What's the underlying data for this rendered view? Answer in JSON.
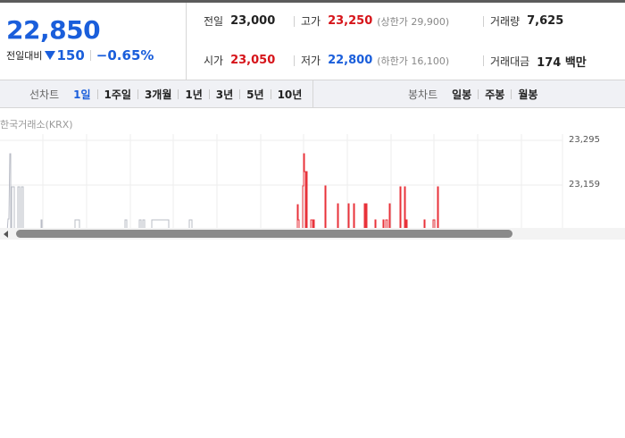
{
  "summary": {
    "price": "22,850",
    "change_label": "전일대비",
    "change_abs": "150",
    "change_pct": "−0.65%",
    "direction": "down",
    "prev_close_label": "전일",
    "prev_close": "23,000",
    "open_label": "시가",
    "open": "23,050",
    "high_label": "고가",
    "high": "23,250",
    "upper_limit": "(상한가 29,900)",
    "low_label": "저가",
    "low": "22,800",
    "lower_limit": "(하한가 16,100)",
    "volume_label": "거래량",
    "volume": "7,625",
    "amount_label": "거래대금",
    "amount": "174 백만"
  },
  "toolbar": {
    "line_chart_label": "선차트",
    "periods": [
      "1일",
      "1주일",
      "3개월",
      "1년",
      "3년",
      "5년",
      "10년"
    ],
    "active_period": "1일",
    "candle_chart_label": "봉차트",
    "candle_periods": [
      "일봉",
      "주봉",
      "월봉"
    ]
  },
  "chart": {
    "source": "한국거래소(KRX)",
    "y_labels": [
      "23,295",
      "23,159"
    ]
  },
  "colors": {
    "up": "#d6141a",
    "down": "#1a5edb",
    "neutral_line": "#b9bcc6"
  },
  "icons": {
    "down_indicator": "triangle-down-icon",
    "scroll_left": "arrow-left-icon"
  }
}
